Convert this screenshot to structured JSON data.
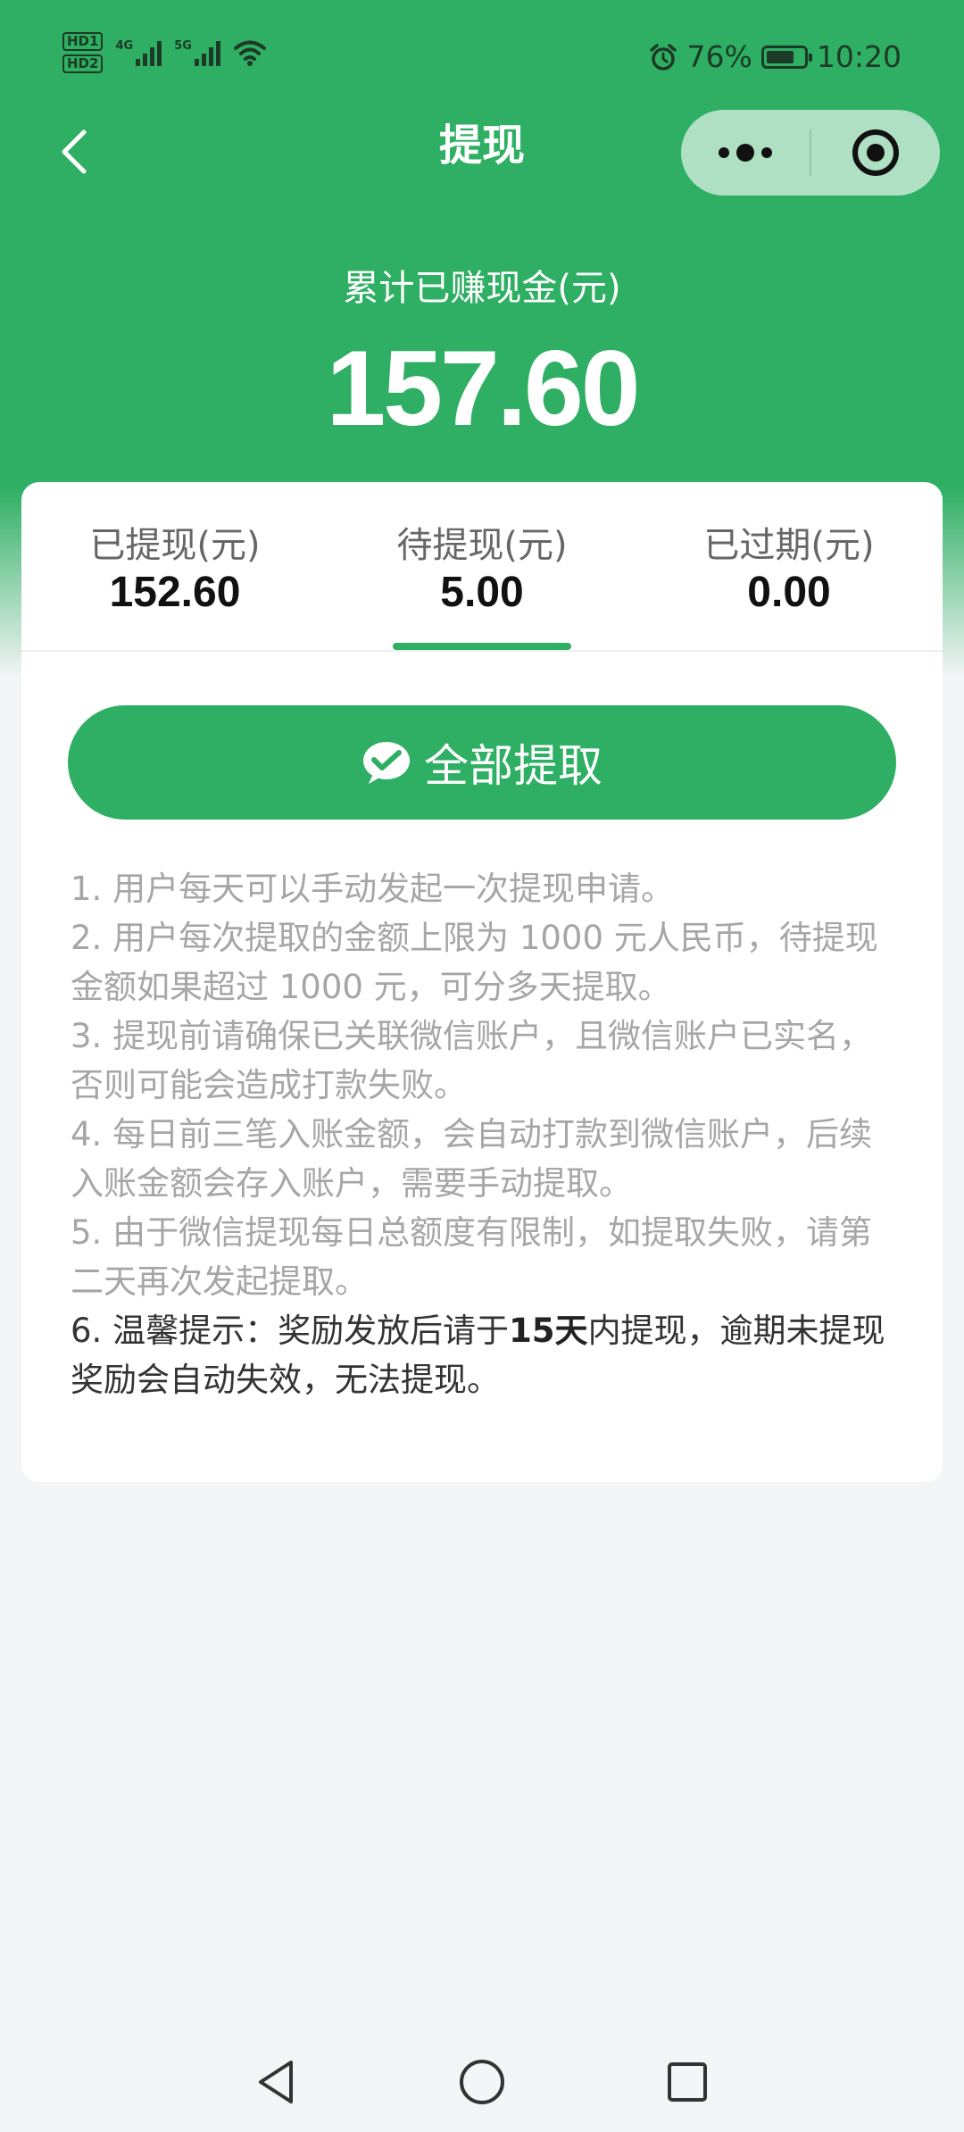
{
  "status_bar": {
    "hd1": "HD1",
    "hd2": "HD2",
    "net1": "4G",
    "net2": "5G",
    "battery_text": "76%",
    "battery_level": 0.76,
    "time": "10:20",
    "icons": [
      "alarm-icon",
      "battery-icon",
      "wifi-icon",
      "signal-icon"
    ]
  },
  "nav": {
    "title": "提现",
    "icons": [
      "back-arrow-icon",
      "more-dots-icon",
      "close-target-icon"
    ]
  },
  "earnings": {
    "label": "累计已赚现金(元)",
    "value": "157.60"
  },
  "tabs": [
    {
      "label": "已提现(元)",
      "value": "152.60"
    },
    {
      "label": "待提现(元)",
      "value": "5.00",
      "active": true
    },
    {
      "label": "已过期(元)",
      "value": "0.00"
    }
  ],
  "withdraw_button": {
    "label": "全部提取",
    "icon": "wechat-pay-icon"
  },
  "rules": [
    "1. 用户每天可以手动发起一次提现申请。",
    "2. 用户每次提取的金额上限为 1000 元人民币，待提现金额如果超过 1000 元，可分多天提取。",
    "3. 提现前请确保已关联微信账户，且微信账户已实名，否则可能会造成打款失败。",
    "4. 每日前三笔入账金额，会自动打款到微信账户，后续入账金额会存入账户，需要手动提取。",
    "5. 由于微信提现每日总额度有限制，如提取失败，请第二天再次发起提取。"
  ],
  "tip": {
    "prefix": "6. 温馨提示：奖励发放后请于",
    "emphasis": "15天",
    "suffix": "内提现，逾期未提现奖励会自动失效，无法提现。"
  },
  "colors": {
    "brand_green": "#2eaf63",
    "background": "#f4f5f7",
    "muted_text": "#a6a6a6"
  }
}
